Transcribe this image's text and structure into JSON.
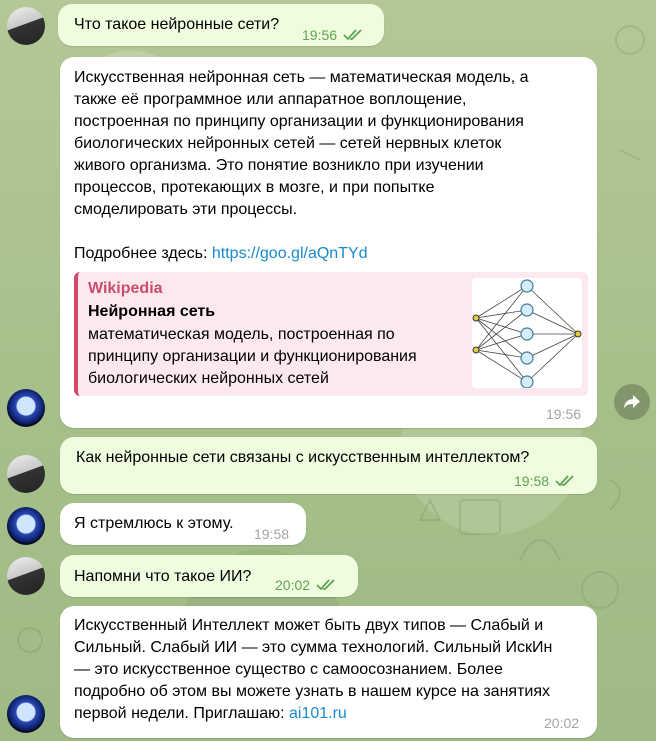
{
  "messages": [
    {
      "text": "Что такое нейронные сети?",
      "time": "19:56"
    },
    {
      "text_lines": [
        "Искусственная нейронная сеть — математическая модель, а",
        "также её программное или аппаратное воплощение,",
        "построенная по принципу организации и функционирования",
        "биологических нейронных сетей — сетей нервных клеток",
        "живого организма. Это понятие возникло при изучении",
        "процессов, протекающих в мозге, и при попытке",
        "смоделировать эти процессы."
      ],
      "more_label": "Подробнее здесь:",
      "link": "https://goo.gl/aQnTYd",
      "preview": {
        "site": "Wikipedia",
        "title": "Нейронная сеть",
        "desc_lines": [
          "математическая модель, построенная по",
          "принципу организации и функционирования",
          "биологических нейронных сетей"
        ]
      },
      "time": "19:56"
    },
    {
      "text": "Как нейронные сети связаны с искусственным интеллектом?",
      "time": "19:58"
    },
    {
      "text": "Я стремлюсь к этому.",
      "time": "19:58"
    },
    {
      "text": "Напомни что такое ИИ?",
      "time": "20:02"
    },
    {
      "text_lines": [
        "Искусственный Интеллект может быть двух типов — Слабый и",
        "Сильный. Слабый ИИ — это сумма технологий. Сильный ИскИн",
        "— это искусственное существо с самоосознанием. Более",
        "подробно об этом вы можете узнать в нашем курсе на занятиях"
      ],
      "last_line": "первой недели. Приглашаю:",
      "link": "ai101.ru",
      "time": "20:02"
    }
  ],
  "icons": {
    "read": "double-check-icon",
    "share": "share-arrow-icon",
    "user_avatar": "user-avatar",
    "bot_avatar": "bot-avatar"
  },
  "colors": {
    "outgoing_bubble": "#effdde",
    "incoming_bubble": "#ffffff",
    "link": "#168acd",
    "check": "#61a257",
    "preview_accent": "#d5476b"
  }
}
